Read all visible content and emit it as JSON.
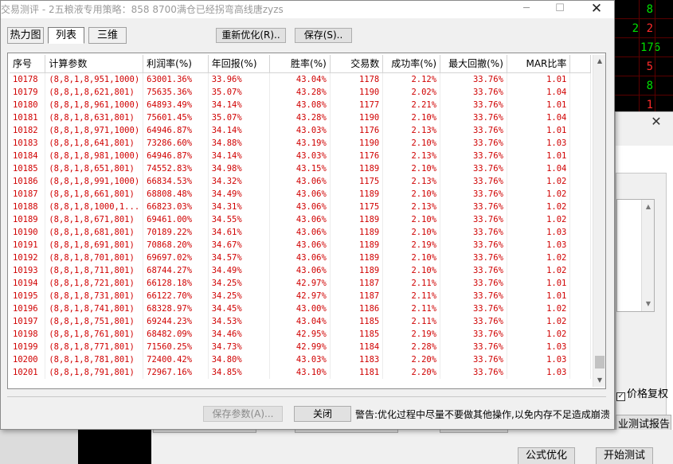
{
  "background_app": {
    "quote_rows": [
      {
        "left": "",
        "right": "8",
        "left_color": "red",
        "right_color": "green"
      },
      {
        "left": "2",
        "right": "2",
        "left_color": "green",
        "right_color": "red"
      },
      {
        "left": "",
        "right": "176",
        "left_color": "red",
        "right_color": "green"
      },
      {
        "left": "",
        "right": "5",
        "left_color": "red",
        "right_color": "red"
      },
      {
        "left": "",
        "right": "8",
        "left_color": "red",
        "right_color": "green"
      },
      {
        "left": "",
        "right": "1",
        "left_color": "red",
        "right_color": "red"
      }
    ],
    "dialog_close": "✕",
    "checkbox_label": "价格复权",
    "checkbox_mark": "✓",
    "report_button": "业测试报告",
    "buttons": {
      "formula_optimize": "公式优化",
      "start_test": "开始测试"
    }
  },
  "window": {
    "title": "交易测评 - 2五粮液专用策略：858 8700满仓已经拐弯高线唐zyzs",
    "minimize": "─",
    "maximize": "☐",
    "close": "✕"
  },
  "tabs": [
    {
      "label": "热力图",
      "active": false
    },
    {
      "label": "列表",
      "active": true
    },
    {
      "label": "三维",
      "active": false
    }
  ],
  "toolbar": {
    "reoptimize": "重新优化(R)..",
    "save": "保存(S).."
  },
  "grid": {
    "columns": [
      "序号",
      "计算参数",
      "利润率(%)",
      "年回报(%)",
      "胜率(%)",
      "交易数",
      "成功率(%)",
      "最大回撤(%)",
      "MAR比率"
    ],
    "rows": [
      [
        "10178",
        "(8,8,1,8,951,1000)",
        "63001.36%",
        "33.96%",
        "43.04%",
        "1178",
        "2.12%",
        "33.76%",
        "1.01"
      ],
      [
        "10179",
        "(8,8,1,8,621,801)",
        "75635.36%",
        "35.07%",
        "43.28%",
        "1190",
        "2.02%",
        "33.76%",
        "1.04"
      ],
      [
        "10180",
        "(8,8,1,8,961,1000)",
        "64893.49%",
        "34.14%",
        "43.08%",
        "1177",
        "2.21%",
        "33.76%",
        "1.01"
      ],
      [
        "10181",
        "(8,8,1,8,631,801)",
        "75601.45%",
        "35.07%",
        "43.28%",
        "1190",
        "2.10%",
        "33.76%",
        "1.04"
      ],
      [
        "10182",
        "(8,8,1,8,971,1000)",
        "64946.87%",
        "34.14%",
        "43.03%",
        "1176",
        "2.13%",
        "33.76%",
        "1.01"
      ],
      [
        "10183",
        "(8,8,1,8,641,801)",
        "73286.60%",
        "34.88%",
        "43.19%",
        "1190",
        "2.10%",
        "33.76%",
        "1.03"
      ],
      [
        "10184",
        "(8,8,1,8,981,1000)",
        "64946.87%",
        "34.14%",
        "43.03%",
        "1176",
        "2.13%",
        "33.76%",
        "1.01"
      ],
      [
        "10185",
        "(8,8,1,8,651,801)",
        "74552.83%",
        "34.98%",
        "43.15%",
        "1189",
        "2.10%",
        "33.76%",
        "1.04"
      ],
      [
        "10186",
        "(8,8,1,8,991,1000)",
        "66834.53%",
        "34.32%",
        "43.06%",
        "1175",
        "2.13%",
        "33.76%",
        "1.02"
      ],
      [
        "10187",
        "(8,8,1,8,661,801)",
        "68808.48%",
        "34.49%",
        "43.06%",
        "1189",
        "2.10%",
        "33.76%",
        "1.02"
      ],
      [
        "10188",
        "(8,8,1,8,1000,1...",
        "66823.03%",
        "34.31%",
        "43.06%",
        "1175",
        "2.13%",
        "33.76%",
        "1.02"
      ],
      [
        "10189",
        "(8,8,1,8,671,801)",
        "69461.00%",
        "34.55%",
        "43.06%",
        "1189",
        "2.10%",
        "33.76%",
        "1.02"
      ],
      [
        "10190",
        "(8,8,1,8,681,801)",
        "70189.22%",
        "34.61%",
        "43.06%",
        "1189",
        "2.10%",
        "33.76%",
        "1.03"
      ],
      [
        "10191",
        "(8,8,1,8,691,801)",
        "70868.20%",
        "34.67%",
        "43.06%",
        "1189",
        "2.19%",
        "33.76%",
        "1.03"
      ],
      [
        "10192",
        "(8,8,1,8,701,801)",
        "69697.02%",
        "34.57%",
        "43.06%",
        "1189",
        "2.10%",
        "33.76%",
        "1.02"
      ],
      [
        "10193",
        "(8,8,1,8,711,801)",
        "68744.27%",
        "34.49%",
        "43.06%",
        "1189",
        "2.10%",
        "33.76%",
        "1.02"
      ],
      [
        "10194",
        "(8,8,1,8,721,801)",
        "66128.18%",
        "34.25%",
        "42.97%",
        "1187",
        "2.11%",
        "33.76%",
        "1.01"
      ],
      [
        "10195",
        "(8,8,1,8,731,801)",
        "66122.70%",
        "34.25%",
        "42.97%",
        "1187",
        "2.11%",
        "33.76%",
        "1.01"
      ],
      [
        "10196",
        "(8,8,1,8,741,801)",
        "68328.97%",
        "34.45%",
        "43.00%",
        "1186",
        "2.11%",
        "33.76%",
        "1.02"
      ],
      [
        "10197",
        "(8,8,1,8,751,801)",
        "69244.23%",
        "34.53%",
        "43.04%",
        "1185",
        "2.11%",
        "33.76%",
        "1.02"
      ],
      [
        "10198",
        "(8,8,1,8,761,801)",
        "68482.09%",
        "34.46%",
        "42.95%",
        "1185",
        "2.19%",
        "33.76%",
        "1.02"
      ],
      [
        "10199",
        "(8,8,1,8,771,801)",
        "71560.25%",
        "34.73%",
        "42.99%",
        "1184",
        "2.28%",
        "33.76%",
        "1.03"
      ],
      [
        "10200",
        "(8,8,1,8,781,801)",
        "72400.42%",
        "34.80%",
        "43.03%",
        "1183",
        "2.20%",
        "33.76%",
        "1.03"
      ],
      [
        "10201",
        "(8,8,1,8,791,801)",
        "72967.16%",
        "34.85%",
        "43.10%",
        "1181",
        "2.20%",
        "33.76%",
        "1.03"
      ]
    ]
  },
  "scrollbar": {
    "up_icon": "▲",
    "down_icon": "▼",
    "position_fraction": 0.98
  },
  "footer": {
    "save_params": "保存参数(A)...",
    "close": "关闭",
    "warning": "警告:优化过程中尽量不要做其他操作,以免内存不足造成崩溃"
  },
  "colors": {
    "data_text": "#d00000",
    "quote_green": "#00e000",
    "quote_red": "#ff2b2b"
  }
}
